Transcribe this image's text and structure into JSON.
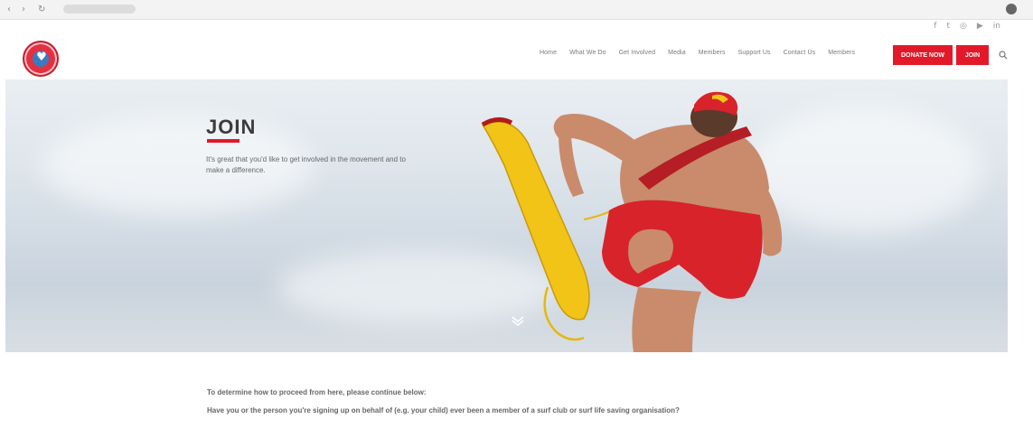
{
  "browser": {
    "back_glyph": "‹",
    "forward_glyph": "›",
    "reload_glyph": "↻"
  },
  "social": [
    {
      "icon": "facebook-icon",
      "glyph": "f"
    },
    {
      "icon": "twitter-icon",
      "glyph": "t"
    },
    {
      "icon": "instagram-icon",
      "glyph": "◎"
    },
    {
      "icon": "youtube-icon",
      "glyph": "▶"
    },
    {
      "icon": "linkedin-icon",
      "glyph": "in"
    }
  ],
  "header": {
    "logo_glyph": "♥",
    "nav": [
      "Home",
      "What We Do",
      "Get Involved",
      "Media",
      "Members",
      "Support Us",
      "Contact Us",
      "Members"
    ],
    "cta_primary": "DONATE NOW",
    "cta_secondary": "JOIN"
  },
  "hero": {
    "title": "JOIN",
    "text": "It's great that you'd like to get involved in the movement and to make a difference."
  },
  "content": {
    "intro": "To determine how to proceed from here, please continue below:",
    "question": "Have you or the person you're signing up on behalf of (e.g. your child) ever been a member of a surf club or surf life saving organisation?"
  },
  "colors": {
    "accent": "#e3192a",
    "shorts": "#d8232a",
    "tube": "#f2c417",
    "skin": "#c98b6b"
  }
}
